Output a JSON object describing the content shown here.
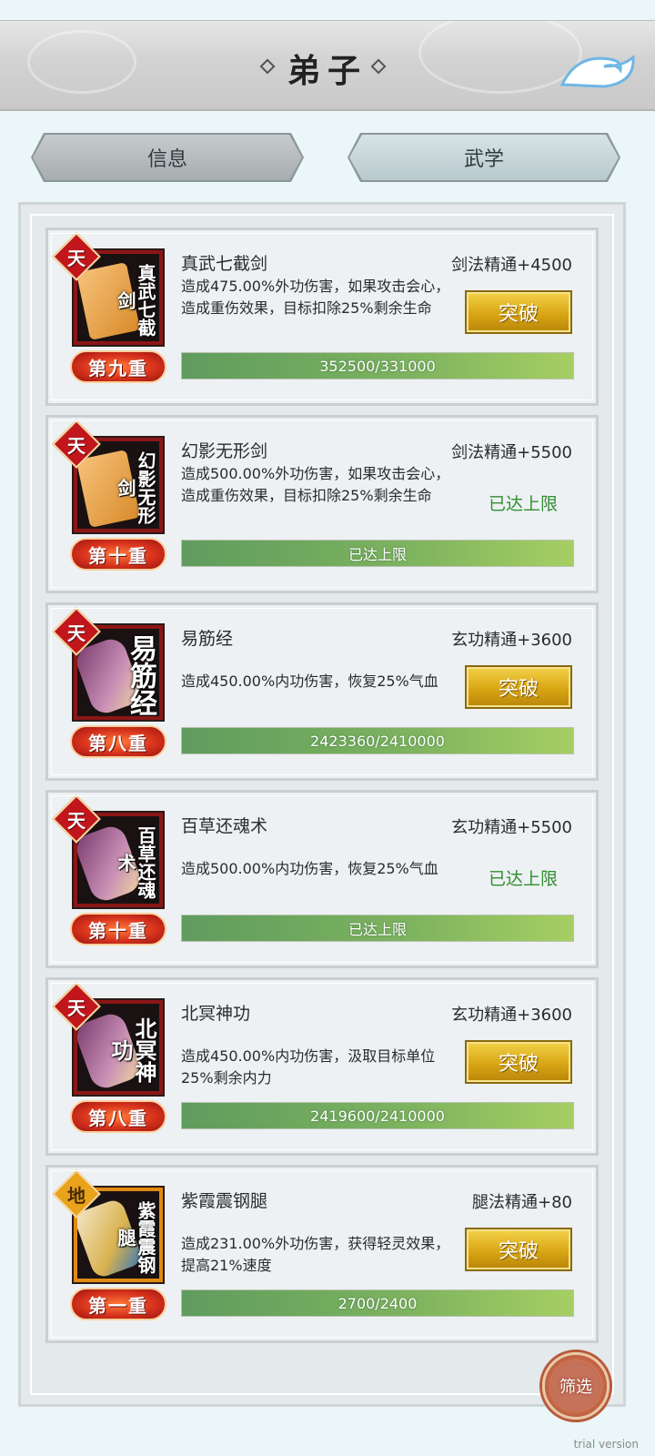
{
  "header": {
    "title": "弟子"
  },
  "tabs": [
    {
      "label": "信息"
    },
    {
      "label": "武学"
    }
  ],
  "skills": [
    {
      "grade": "天",
      "icon_name": "真武七截剑",
      "name": "真武七截剑",
      "mastery": "剑法精通+4500",
      "desc": "造成475.00%外功伤害，如果攻击会心，造成重伤效果，目标扣除25%剩余生命",
      "level": "第九重",
      "action": "突破",
      "progress_text": "352500/331000",
      "progress": 1.0,
      "art": "book"
    },
    {
      "grade": "天",
      "icon_name": "幻影无形剑",
      "name": "幻影无形剑",
      "mastery": "剑法精通+5500",
      "desc": "造成500.00%外功伤害，如果攻击会心，造成重伤效果，目标扣除25%剩余生命",
      "level": "第十重",
      "status": "已达上限",
      "progress_text": "已达上限",
      "progress": 1.0,
      "art": "book"
    },
    {
      "grade": "天",
      "icon_name": "易筋经",
      "name": "易筋经",
      "mastery": "玄功精通+3600",
      "desc": "造成450.00%内功伤害，恢复25%气血",
      "level": "第八重",
      "action": "突破",
      "progress_text": "2423360/2410000",
      "progress": 1.0,
      "art": "scroll"
    },
    {
      "grade": "天",
      "icon_name": "百草还魂术",
      "name": "百草还魂术",
      "mastery": "玄功精通+5500",
      "desc": "造成500.00%内功伤害，恢复25%气血",
      "level": "第十重",
      "status": "已达上限",
      "progress_text": "已达上限",
      "progress": 1.0,
      "art": "scroll"
    },
    {
      "grade": "天",
      "icon_name": "北冥神功",
      "name": "北冥神功",
      "mastery": "玄功精通+3600",
      "desc": "造成450.00%内功伤害，汲取目标单位25%剩余内力",
      "level": "第八重",
      "action": "突破",
      "progress_text": "2419600/2410000",
      "progress": 1.0,
      "art": "scroll"
    },
    {
      "grade": "地",
      "icon_name": "紫霞震钢腿",
      "name": "紫霞震钢腿",
      "mastery": "腿法精通+80",
      "desc": "造成231.00%外功伤害，获得轻灵效果，提高21%速度",
      "level": "第一重",
      "action": "突破",
      "progress_text": "2700/2400",
      "progress": 1.0,
      "art": "scroll2"
    }
  ],
  "filter_label": "筛选",
  "watermark": "trial version",
  "colors": {
    "maxed_text": "#2f8e2f",
    "progress_fill": "#7fb45f",
    "break_button": "#d9a614"
  }
}
